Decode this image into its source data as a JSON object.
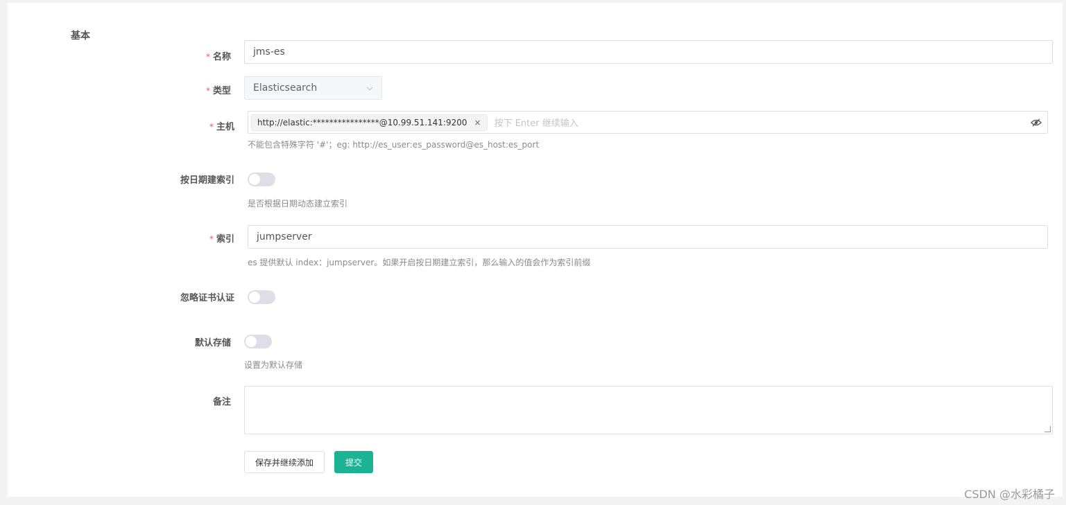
{
  "section": {
    "title": "基本"
  },
  "form": {
    "required_mark": "*",
    "name": {
      "label": "名称",
      "value": "jms-es"
    },
    "type": {
      "label": "类型",
      "value": "Elasticsearch",
      "icon": "chevron-down-icon"
    },
    "hosts": {
      "label": "主机",
      "tags": [
        "http://elastic:****************@10.99.51.141:9200"
      ],
      "tag_close": "×",
      "placeholder": "按下 Enter 继续输入",
      "help": "不能包含特殊字符 '#'；eg: http://es_user:es_password@es_host:es_port",
      "icon": "eye-off-icon"
    },
    "index_by_date": {
      "label": "按日期建索引",
      "checked": false,
      "help": "是否根据日期动态建立索引"
    },
    "index": {
      "label": "索引",
      "value": "jumpserver",
      "help": "es 提供默认 index：jumpserver。如果开启按日期建立索引，那么输入的值会作为索引前缀"
    },
    "ignore_verify": {
      "label": "忽略证书认证",
      "checked": false
    },
    "is_default": {
      "label": "默认存储",
      "checked": false,
      "help": "设置为默认存储"
    },
    "comment": {
      "label": "备注",
      "value": ""
    }
  },
  "buttons": {
    "save_continue": "保存并继续添加",
    "submit": "提交"
  },
  "colors": {
    "primary": "#1ab394",
    "required": "#ed5565"
  },
  "watermark": "CSDN @水彩橘子"
}
